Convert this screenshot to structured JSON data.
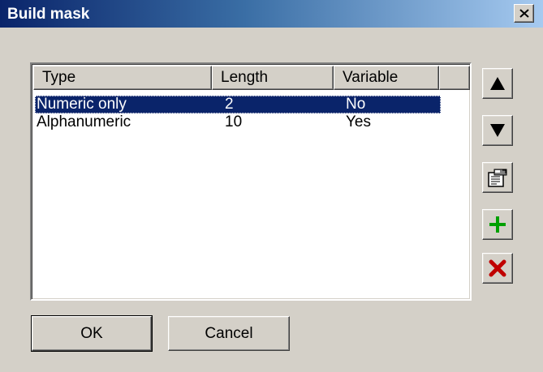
{
  "window": {
    "title": "Build mask",
    "close_icon": "close-x-icon"
  },
  "table": {
    "columns": [
      "Type",
      "Length",
      "Variable"
    ],
    "rows": [
      {
        "type": "Numeric only",
        "length": "2",
        "variable": "No",
        "selected": true
      },
      {
        "type": "Alphanumeric",
        "length": "10",
        "variable": "Yes",
        "selected": false
      }
    ]
  },
  "side_buttons": {
    "move_up_icon": "arrow-up-icon",
    "move_down_icon": "arrow-down-icon",
    "properties_icon": "properties-icon",
    "add_icon": "plus-icon",
    "delete_icon": "delete-x-icon"
  },
  "colors": {
    "selection": "#0a246a",
    "add": "#00a000",
    "delete": "#c00000"
  },
  "buttons": {
    "ok_label": "OK",
    "cancel_label": "Cancel"
  }
}
